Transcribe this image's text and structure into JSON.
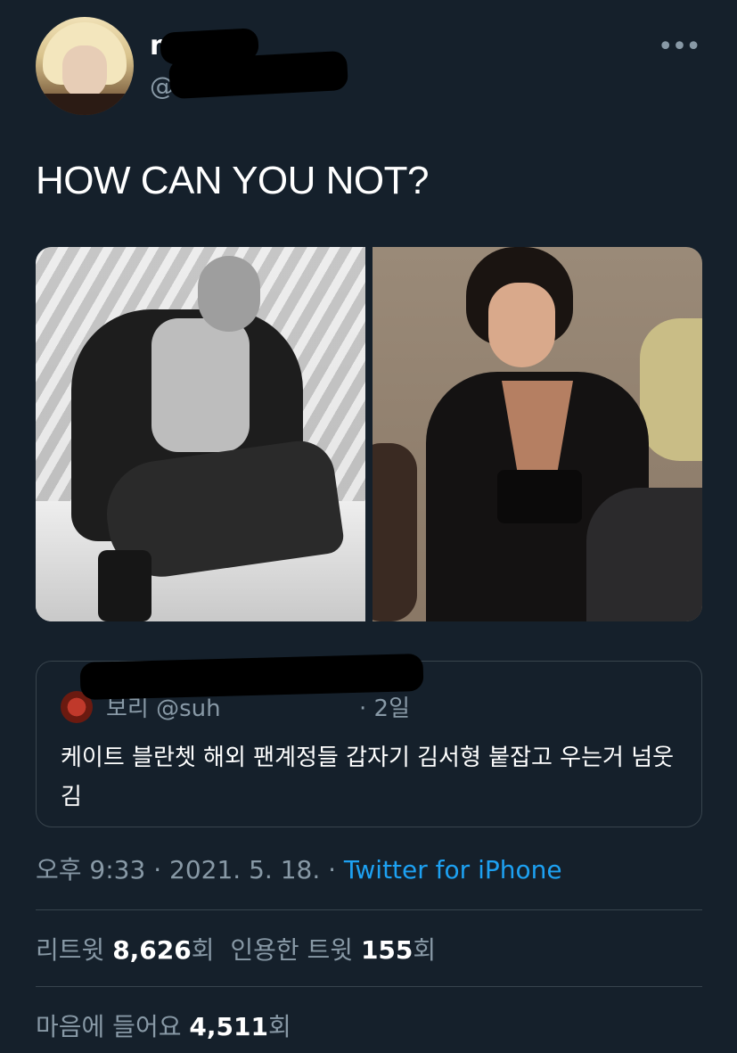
{
  "tweet": {
    "name": "mi",
    "handle": "@",
    "text": "HOW CAN YOU NOT?",
    "more_label": "•••"
  },
  "quoted_tweet": {
    "author_meta": "보리 @suh",
    "time": "· 2일",
    "text": "케이트 블란쳇 해외 팬계정들 갑자기 김서형 붙잡고 우는거 넘웃김"
  },
  "meta": {
    "time": "오후 9:33",
    "separator1": " · ",
    "date": "2021. 5. 18.",
    "separator2": " · ",
    "source": "Twitter for iPhone"
  },
  "stats": {
    "retweets_label": "리트윗",
    "retweets_count": "8,626",
    "retweets_unit": "회",
    "quotes_label": "인용한 트윗",
    "quotes_count": "155",
    "quotes_unit": "회",
    "likes_label": "마음에 들어요",
    "likes_count": "4,511",
    "likes_unit": "회"
  },
  "colors": {
    "background": "#15202b",
    "secondary_text": "#8899a6",
    "link": "#1da1f2",
    "border": "#38444d"
  }
}
